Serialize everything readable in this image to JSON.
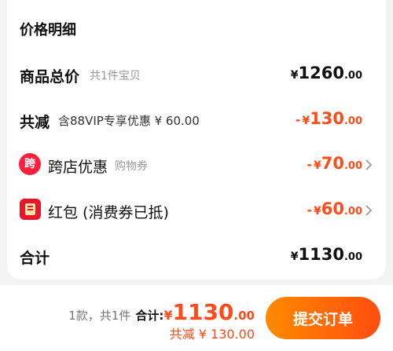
{
  "section_title": "价格明细",
  "goods_total": {
    "label": "商品总价",
    "sub": "共1件宝贝",
    "currency": "¥",
    "int": "1260",
    "dec": ".00"
  },
  "total_discount": {
    "label": "共减",
    "sub": "含88VIP专享优惠 ¥ 60.00",
    "minus": "-",
    "currency": "¥",
    "int": "130",
    "dec": ".00"
  },
  "cross_store": {
    "icon_text": "跨",
    "label": "跨店优惠",
    "sub": "购物券",
    "minus": "-",
    "currency": "¥",
    "int": "70",
    "dec": ".00"
  },
  "red_packet": {
    "label": "红包 (消费券已抵)",
    "minus": "-",
    "currency": "¥",
    "int": "60",
    "dec": ".00"
  },
  "subtotal": {
    "label": "合计",
    "currency": "¥",
    "int": "1130",
    "dec": ".00"
  },
  "footer": {
    "count_text": "1款，共1件",
    "total_label": "合计:",
    "currency": "¥",
    "int": "1130",
    "dec": ".00",
    "saved_text": "共减 ¥ 130.00",
    "submit_label": "提交订单"
  },
  "colors": {
    "accent": "#ff4a1a",
    "button_start": "#ff8a00",
    "button_end": "#ff4d0f",
    "cross_store_icon": "#ff1e3c",
    "red_packet_icon": "#e8152d"
  },
  "icons": [
    "cross-store-icon",
    "red-packet-icon",
    "chevron-right-icon"
  ]
}
